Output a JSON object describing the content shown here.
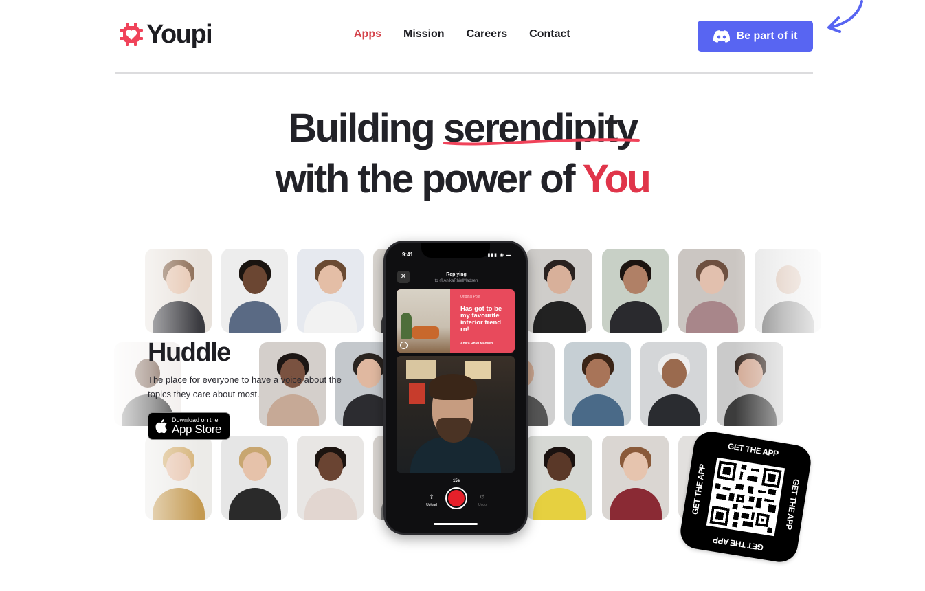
{
  "brand": {
    "name": "Youpi",
    "accent": "#f0435a"
  },
  "nav": {
    "items": [
      {
        "label": "Apps",
        "active": true
      },
      {
        "label": "Mission",
        "active": false
      },
      {
        "label": "Careers",
        "active": false
      },
      {
        "label": "Contact",
        "active": false
      }
    ],
    "cta_label": "Be part of it",
    "cta_color": "#5865f2"
  },
  "hero": {
    "line1_prefix": "Building ",
    "line1_highlight": "serendipity",
    "line2_prefix": "with the power of ",
    "line2_accent": "You",
    "accent_color": "#e0354a"
  },
  "app": {
    "name": "Huddle",
    "description": "The place for everyone to have a voice about the topics they care about most.",
    "store_small": "Download on the",
    "store_big": "App Store"
  },
  "phone": {
    "time": "9:41",
    "status": "▮▮▮ ◉ ▬",
    "close": "✕",
    "title": "Replying",
    "subtitle": "to @AnikaRhielMadsen",
    "original_label": "Original Post",
    "original_text": "Has got to be my favourite interior trend rn!",
    "original_author": "Anika Rhiel Madsen",
    "duration": "15s",
    "upload_label": "Upload",
    "undo_label": "Undo"
  },
  "qr": {
    "label": "GET THE APP"
  },
  "icons": {
    "logo": "heart-chip-icon",
    "discord": "discord-icon",
    "apple": "apple-icon",
    "arrow": "curved-arrow-icon",
    "upload": "upload-icon",
    "undo": "undo-icon"
  }
}
